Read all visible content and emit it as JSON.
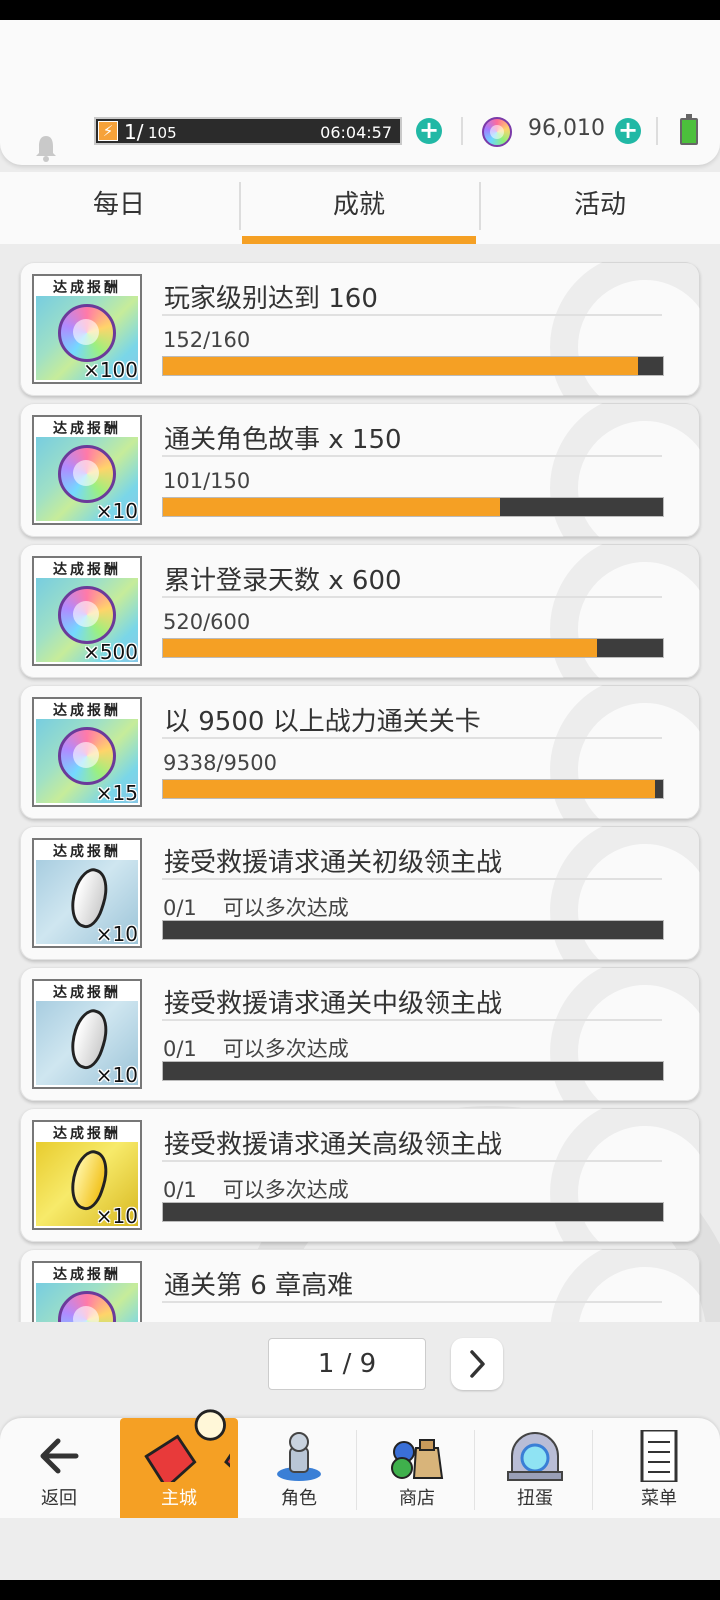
{
  "header": {
    "stamina_current": "1/",
    "stamina_max": "105",
    "timer": "06:04:57",
    "gems": "96,010",
    "colors": {
      "accent": "#f5a024",
      "plus": "#21b8a5"
    }
  },
  "tabs": [
    {
      "label": "每日"
    },
    {
      "label": "成就"
    },
    {
      "label": "活动"
    }
  ],
  "active_tab": "成就",
  "reward_label": "达成报酬",
  "achievements": [
    {
      "title": "玩家级别达到 160",
      "progress": "152/160",
      "note": "",
      "reward_qty": "×100",
      "fill": 0.95,
      "reward": "rainbow-orb"
    },
    {
      "title": "通关角色故事  x 150",
      "progress": "101/150",
      "note": "",
      "reward_qty": "×10",
      "fill": 0.673,
      "reward": "rainbow-orb"
    },
    {
      "title": "累计登录天数  x 600",
      "progress": "520/600",
      "note": "",
      "reward_qty": "×500",
      "fill": 0.867,
      "reward": "rainbow-orb"
    },
    {
      "title": "以 9500 以上战力通关关卡",
      "progress": "9338/9500",
      "note": "",
      "reward_qty": "×15",
      "fill": 0.983,
      "reward": "rainbow-orb"
    },
    {
      "title": "接受救援请求通关初级领主战",
      "progress": "0/1",
      "note": "可以多次达成",
      "reward_qty": "×10",
      "fill": 0,
      "reward": "silver-shard"
    },
    {
      "title": "接受救援请求通关中级领主战",
      "progress": "0/1",
      "note": "可以多次达成",
      "reward_qty": "×10",
      "fill": 0,
      "reward": "silver-shard"
    },
    {
      "title": "接受救援请求通关高级领主战",
      "progress": "0/1",
      "note": "可以多次达成",
      "reward_qty": "×10",
      "fill": 0,
      "reward": "gold-shard"
    },
    {
      "title": "通关第 6 章高难",
      "progress": "",
      "note": "",
      "reward_qty": "",
      "fill": 0,
      "reward": "rainbow-orb"
    }
  ],
  "pagination": {
    "label": "1 / 9"
  },
  "nav": [
    {
      "label": "返回",
      "icon": "back-arrow-icon"
    },
    {
      "label": "主城",
      "icon": "castle-icon"
    },
    {
      "label": "角色",
      "icon": "character-icon"
    },
    {
      "label": "商店",
      "icon": "shop-icon"
    },
    {
      "label": "扭蛋",
      "icon": "gacha-icon"
    },
    {
      "label": "菜单",
      "icon": "menu-icon"
    }
  ]
}
